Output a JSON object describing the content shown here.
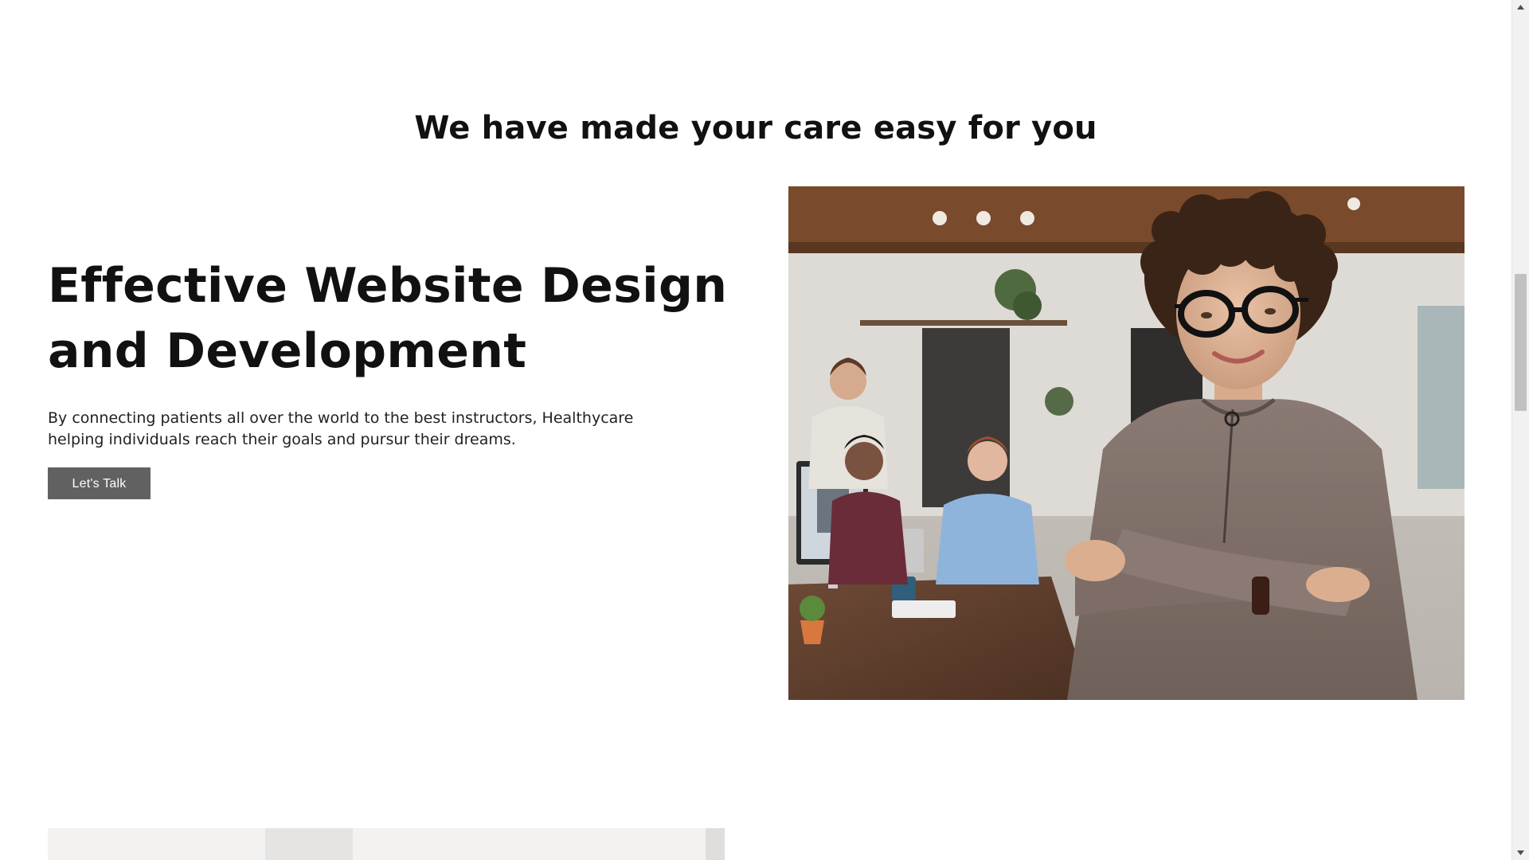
{
  "section": {
    "title": "We have made your care easy for you"
  },
  "hero": {
    "heading": "Effective Website Design and Development",
    "description": "By connecting patients all over the world to the best instructors, Healthycare helping individuals reach their goals and pursur their dreams.",
    "cta_label": "Let's Talk",
    "cta_color": "#616161",
    "image_subject": "photo-woman-glasses-arms-crossed-office"
  },
  "bottom": {
    "image_subject": "photo-partial-next-section"
  },
  "scrollbar": {
    "up_icon": "triangle-up-icon",
    "down_icon": "triangle-down-icon"
  }
}
